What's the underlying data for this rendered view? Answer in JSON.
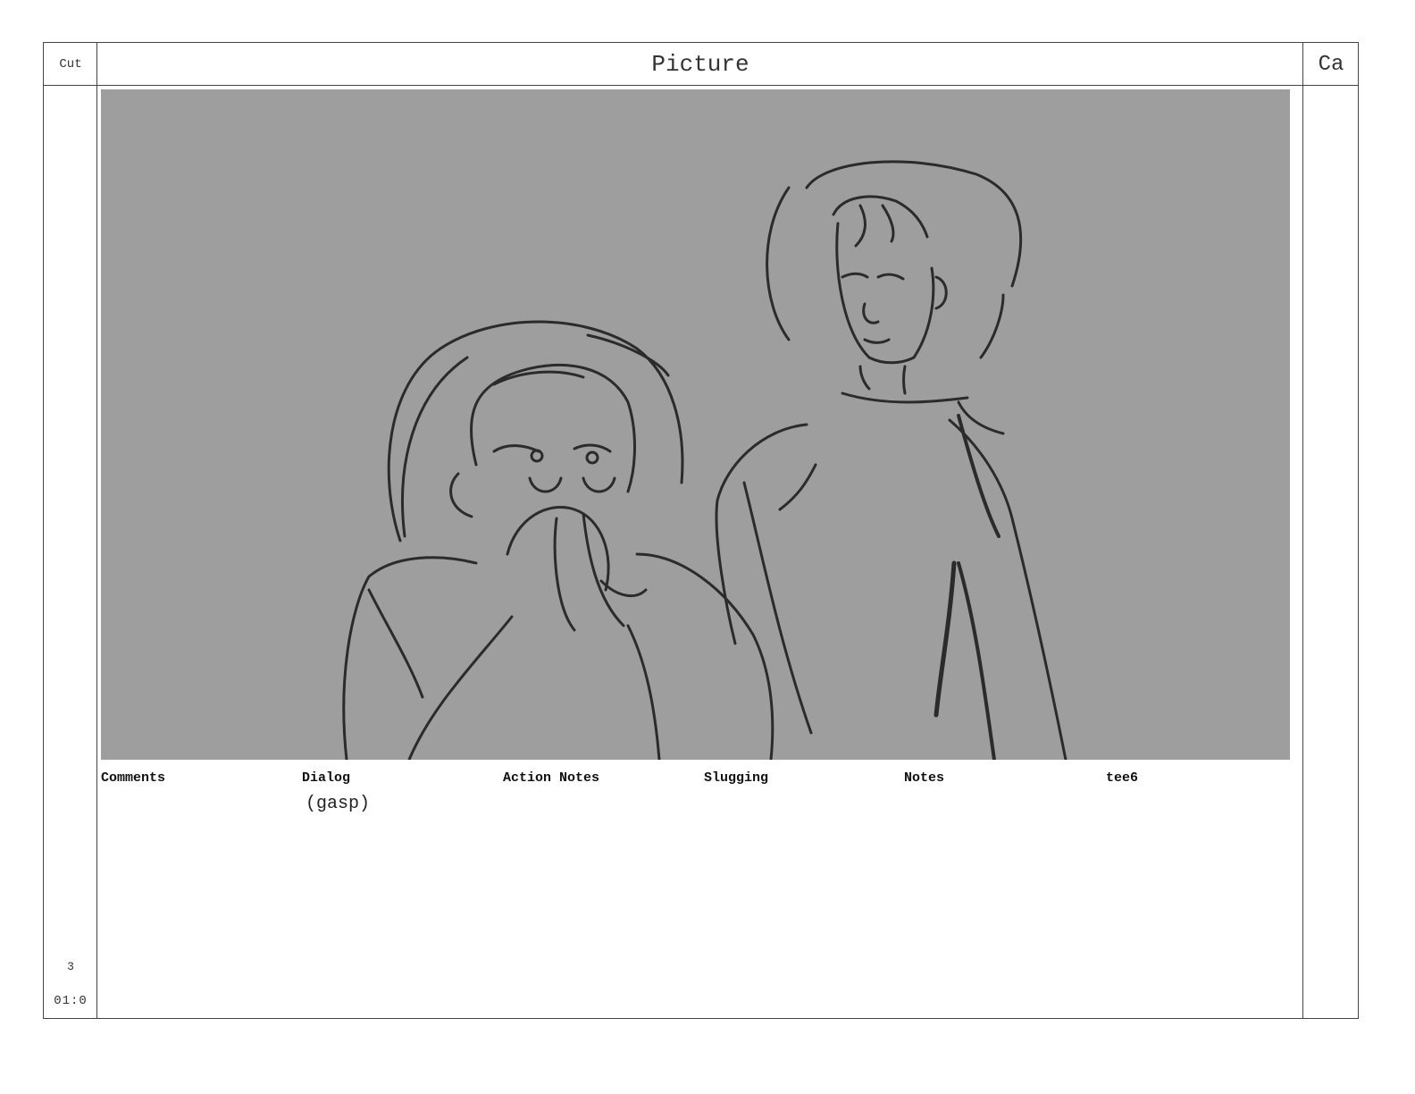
{
  "header": {
    "cut_label": "Cut",
    "picture_label": "Picture",
    "camera_label": "Ca"
  },
  "panel": {
    "background_color": "#9e9e9e",
    "sketch": "two-characters-line-sketch"
  },
  "fields": {
    "comments": {
      "label": "Comments",
      "value": ""
    },
    "dialog": {
      "label": "Dialog",
      "value": "(gasp)"
    },
    "action_notes": {
      "label": "Action Notes",
      "value": ""
    },
    "slugging": {
      "label": "Slugging",
      "value": ""
    },
    "notes": {
      "label": "Notes",
      "value": ""
    },
    "tee6": {
      "label": "tee6",
      "value": ""
    }
  },
  "footer": {
    "scene_number": "3",
    "timecode": "01:0"
  }
}
